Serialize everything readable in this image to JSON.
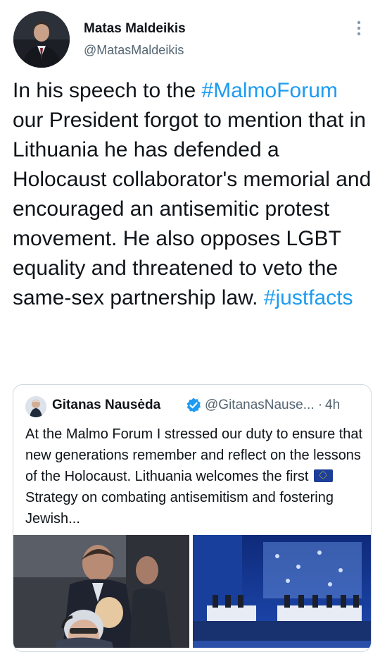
{
  "author": {
    "name": "Matas Maldeikis",
    "handle": "@MatasMaldeikis"
  },
  "tweet": {
    "segments": [
      {
        "text": "In his speech to the ",
        "type": "text"
      },
      {
        "text": "#MalmoForum",
        "type": "hashtag"
      },
      {
        "text": " our President forgot to mention that in Lithuania he has defended a Holocaust collaborator's memorial and encouraged an antisemitic protest movement. He also opposes LGBT equality and threatened to veto the same-sex partnership law. ",
        "type": "text"
      },
      {
        "text": "#justfacts",
        "type": "hashtag"
      }
    ]
  },
  "quoted": {
    "name": "Gitanas Nausėda",
    "handle": "@GitanasNause...",
    "time_sep": "·",
    "time": "4h",
    "text_before_flag": "At the Malmo Forum I stressed our duty to ensure that new generations remember and reflect on the lessons of the Holocaust. Lithuania welcomes the first ",
    "text_after_flag": " Strategy on combating antisemitism and fostering Jewish..."
  },
  "icons": {
    "more": "more-vertical-icon",
    "verified": "verified-badge-icon",
    "flag": "eu-flag-icon"
  },
  "colors": {
    "link": "#1d9bf0",
    "secondary_text": "#536471",
    "border": "#cfd9de",
    "verified": "#1d9bf0"
  }
}
